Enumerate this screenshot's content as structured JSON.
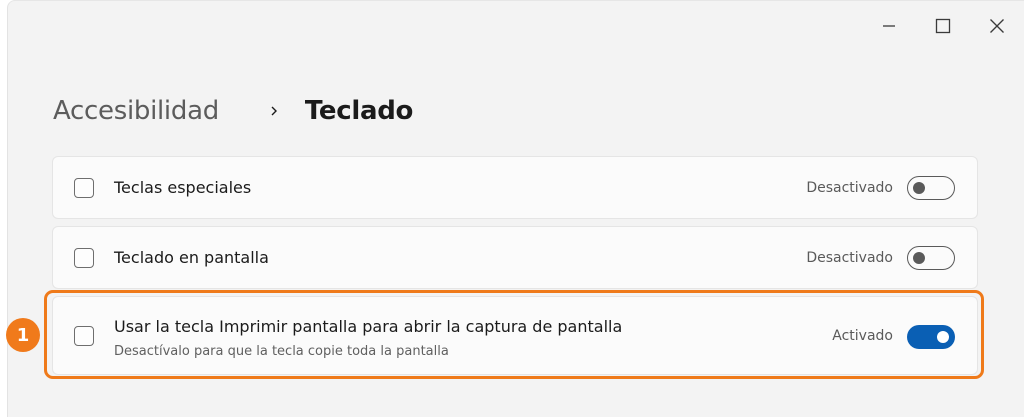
{
  "window": {
    "controls": [
      {
        "name": "minimize-icon"
      },
      {
        "name": "maximize-icon"
      },
      {
        "name": "close-icon"
      }
    ]
  },
  "breadcrumb": {
    "parent": "Accesibilidad",
    "separator_icon": "chevron-right-icon",
    "current": "Teclado"
  },
  "settings": [
    {
      "label": "Teclas especiales",
      "state": "Desactivado",
      "enabled": false
    },
    {
      "label": "Teclado en pantalla",
      "state": "Desactivado",
      "enabled": false
    },
    {
      "label": "Usar la tecla Imprimir pantalla para abrir la captura de pantalla",
      "description": "Desactívalo para que la tecla copie toda la pantalla",
      "state": "Activado",
      "enabled": true
    }
  ],
  "annotation": {
    "step_number": "1",
    "color": "#EF7A1A"
  },
  "colors": {
    "toggle_on": "#0A5FB4",
    "background": "#F3F3F3"
  }
}
